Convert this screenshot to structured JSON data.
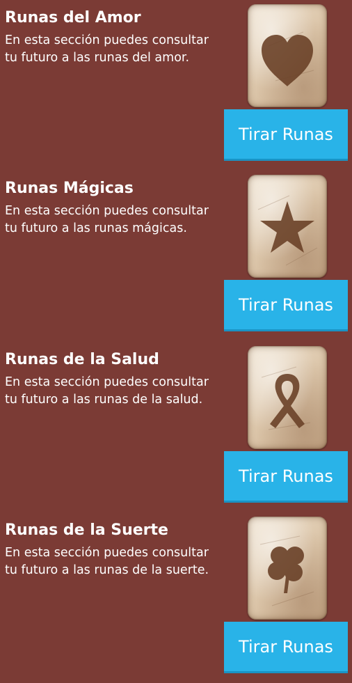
{
  "sections": [
    {
      "title": "Runas del Amor",
      "description": "En esta sección puedes consultar tu futuro a las runas del amor.",
      "icon": "heart-rune-icon",
      "button_label": "Tirar Runas"
    },
    {
      "title": "Runas Mágicas",
      "description": "En esta sección puedes consultar tu futuro a las runas mágicas.",
      "icon": "star-rune-icon",
      "button_label": "Tirar Runas"
    },
    {
      "title": "Runas de la Salud",
      "description": "En esta sección puedes consultar tu futuro a las runas de la salud.",
      "icon": "ribbon-rune-icon",
      "button_label": "Tirar Runas"
    },
    {
      "title": "Runas de la Suerte",
      "description": "En esta sección puedes consultar tu futuro a las runas de la suerte.",
      "icon": "clover-rune-icon",
      "button_label": "Tirar Runas"
    }
  ],
  "colors": {
    "background": "#7b3b35",
    "button": "#29b3e8",
    "text": "#ffffff",
    "symbol": "#6a4128"
  }
}
